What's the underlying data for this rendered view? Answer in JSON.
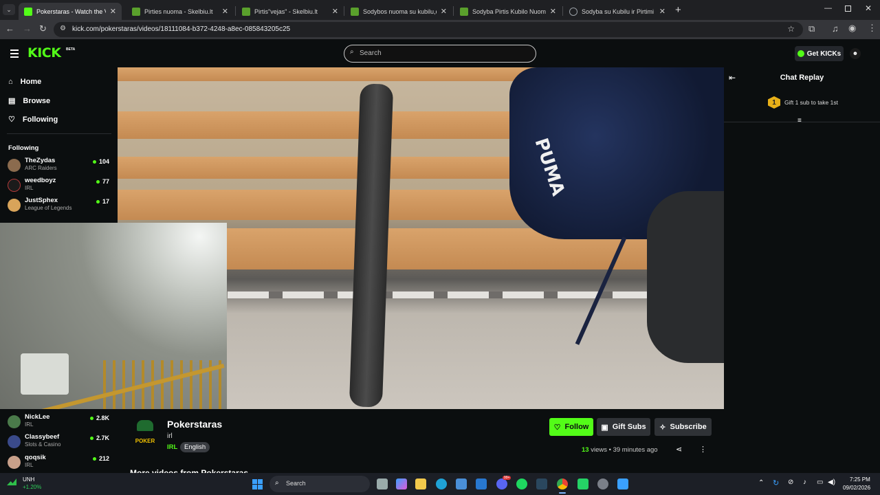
{
  "browser": {
    "tabs": [
      {
        "title": "Pokerstaras - Watch the VOD o",
        "active": true,
        "favicon_color": "#53fc18"
      },
      {
        "title": "Pirties nuoma - Skelbiu.lt",
        "active": false,
        "favicon_color": "#7ed321"
      },
      {
        "title": "Pirtis\"vejas\" - Skelbiu.lt",
        "active": false,
        "favicon_color": "#7ed321"
      },
      {
        "title": "Sodybos nuoma su kubilu,džiak",
        "active": false,
        "favicon_color": "#7ed321"
      },
      {
        "title": "Sodyba Pirtis Kubilo Nuoma so",
        "active": false,
        "favicon_color": "#7ed321"
      },
      {
        "title": "Sodyba su Kubilu ir Pirtimi - Nu",
        "active": false,
        "favicon_color": "#9aa0a6"
      }
    ],
    "url": "kick.com/pokerstaras/videos/18111084-b372-4248-a8ec-085843205c25"
  },
  "header": {
    "logo": "KICK",
    "logo_badge": "BETA",
    "search_placeholder": "Search",
    "get_kicks": "Get KICKs"
  },
  "sidebar": {
    "nav": [
      {
        "label": "Home",
        "icon": "home-icon"
      },
      {
        "label": "Browse",
        "icon": "browse-icon"
      },
      {
        "label": "Following",
        "icon": "heart-icon"
      }
    ],
    "following_title": "Following",
    "following": [
      {
        "name": "TheZydas",
        "category": "ARC Raiders",
        "viewers": "104",
        "avatar_color": "#8b6b4e"
      },
      {
        "name": "weedboyz",
        "category": "IRL",
        "viewers": "77",
        "avatar_color": "#b33a3a"
      },
      {
        "name": "JustSphex",
        "category": "League of Legends",
        "viewers": "17",
        "avatar_color": "#d8a45a"
      }
    ],
    "recommended": [
      {
        "name": "NickLee",
        "category": "IRL",
        "viewers": "2.8K",
        "avatar_color": "#4a7a4a"
      },
      {
        "name": "Classybeef",
        "category": "Slots & Casino",
        "viewers": "2.7K",
        "avatar_color": "#3a4a8a"
      },
      {
        "name": "qoqsik",
        "category": "IRL",
        "viewers": "212",
        "avatar_color": "#c8a08a"
      }
    ]
  },
  "chat": {
    "title": "Chat Replay",
    "gift_rank": "1",
    "gift_text": "Gift 1 sub to take 1st"
  },
  "video_info": {
    "channel": "Pokerstaras",
    "subtitle": "irl",
    "category": "IRL",
    "language": "English",
    "views_count": "13",
    "views_label": "views",
    "age": "39 minutes ago",
    "follow": "Follow",
    "gift_subs": "Gift Subs",
    "subscribe": "Subscribe",
    "more_videos": "More videos from Pokerstaras",
    "avatar_text": "POKER"
  },
  "taskbar": {
    "ticker": "UNH",
    "ticker_change": "+1.20%",
    "search_placeholder": "Search",
    "time": "7:25 PM",
    "date": "09/02/2026",
    "mail_badge": "99+"
  }
}
